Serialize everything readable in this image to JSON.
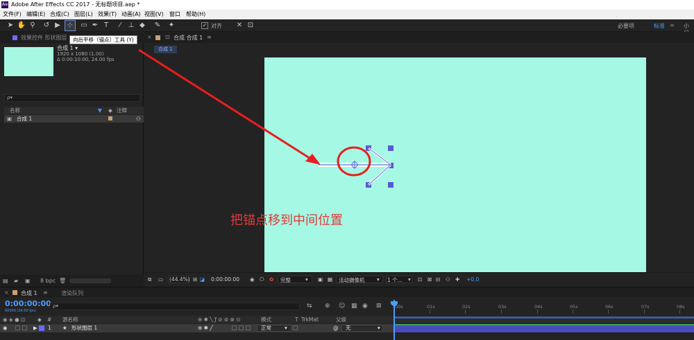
{
  "window": {
    "logo": "Ae",
    "title": "Adobe After Effects CC 2017 - 无标题项目.aep *"
  },
  "menu": [
    "文件(F)",
    "编辑(E)",
    "合成(C)",
    "图层(L)",
    "效果(T)",
    "动画(A)",
    "视图(V)",
    "窗口",
    "帮助(H)"
  ],
  "toolbar": {
    "tooltip": "向后平移（锚点）工具 (Y)",
    "snap_label": "对齐",
    "workspaces": [
      "必要项",
      "标准",
      "小屏"
    ]
  },
  "left_panel": {
    "tabs": [
      "效果控件 形状图层"
    ],
    "comp_name": "合成 1 ▾",
    "comp_size": "1920 x 1080 (1.00)",
    "comp_duration": "Δ 0:00:10:00, 24.00 fps",
    "search_placeholder": "ρ▾",
    "header_name": "名称",
    "header_comment": "注释",
    "row_name": "合成 1",
    "bpc": "8 bpc"
  },
  "viewer": {
    "tab_label": "合成 合成 1",
    "breadcrumb": "合成 1",
    "zoom": "(44.4%)",
    "timecode": "0:00:00:00",
    "resolution": "完整",
    "camera": "活动摄像机",
    "views": "1 个...",
    "exposure": "+0.0"
  },
  "annotation": "把锚点移到中间位置",
  "timeline": {
    "tabs": [
      "合成 1",
      "渲染队列"
    ],
    "timecode": "0:00:00:00",
    "timecode_sub": "00000 (24.00 fps)",
    "search_placeholder": "ρ▾",
    "header_num": "#",
    "header_source": "源名称",
    "header_mode": "模式",
    "header_t": "T",
    "header_trkmat": "TrkMat",
    "header_parent": "父级",
    "layer_index": "1",
    "layer_name": "形状图层 1",
    "layer_mode": "正常",
    "layer_parent": "无",
    "ruler": [
      "00s",
      "01s",
      "02s",
      "03s",
      "04s",
      "05s",
      "06s",
      "07s",
      "08s"
    ]
  },
  "colors": {
    "canvas": "#a5f8e3",
    "accent_blue": "#4a9dff",
    "annotation_red": "#e23a3a",
    "layer_bar": "#4a4abf"
  }
}
